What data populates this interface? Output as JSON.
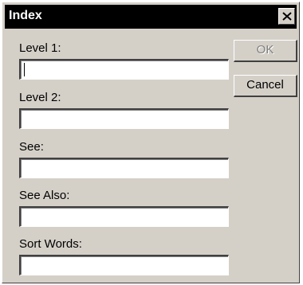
{
  "window": {
    "title": "Index"
  },
  "buttons": {
    "ok_label": "OK",
    "cancel_label": "Cancel"
  },
  "fields": [
    {
      "label": "Level 1:",
      "value": ""
    },
    {
      "label": "Level 2:",
      "value": ""
    },
    {
      "label": "See:",
      "value": ""
    },
    {
      "label": "See Also:",
      "value": ""
    },
    {
      "label": "Sort Words:",
      "value": ""
    }
  ],
  "icons": {
    "close": "close-icon"
  },
  "colors": {
    "titlebar": "#000000",
    "dialog_face": "#d4d0c8"
  }
}
